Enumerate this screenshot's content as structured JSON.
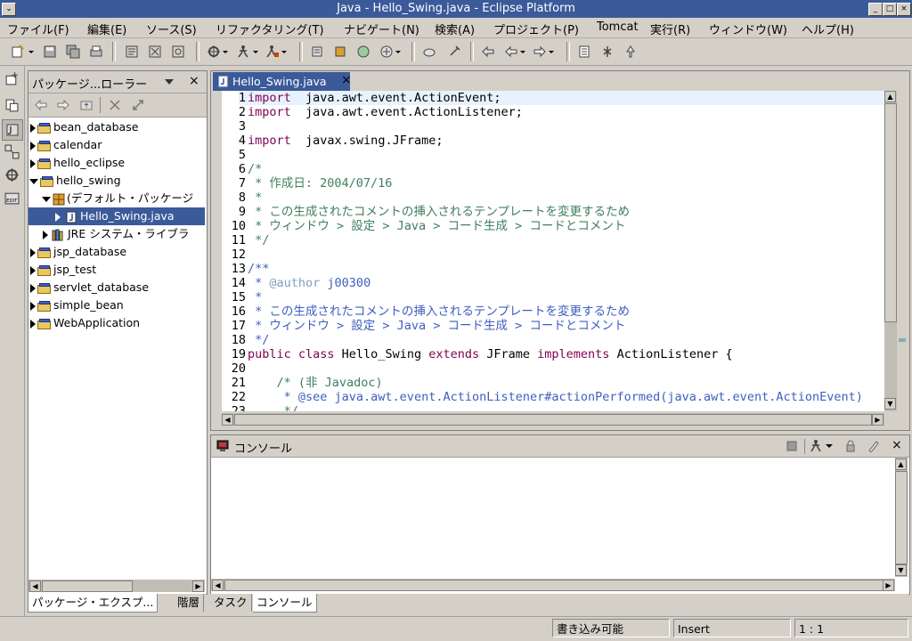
{
  "window": {
    "title": "Java - Hello_Swing.java - Eclipse Platform"
  },
  "menu": [
    "ファイル(F)",
    "編集(E)",
    "ソース(S)",
    "リファクタリング(T)",
    "ナビゲート(N)",
    "検索(A)",
    "プロジェクト(P)",
    "Tomcat",
    "実行(R)",
    "ウィンドウ(W)",
    "ヘルプ(H)"
  ],
  "explorer": {
    "title": "パッケージ...ローラー",
    "items": [
      {
        "label": "bean_database",
        "expanded": false
      },
      {
        "label": "calendar",
        "expanded": false
      },
      {
        "label": "hello_eclipse",
        "expanded": false
      },
      {
        "label": "hello_swing",
        "expanded": true
      },
      {
        "label": "(デフォルト・パッケージ",
        "expanded": true
      },
      {
        "label": "Hello_Swing.java",
        "selected": true
      },
      {
        "label": "JRE システム・ライブラ",
        "expanded": false
      },
      {
        "label": "jsp_database",
        "expanded": false
      },
      {
        "label": "jsp_test",
        "expanded": false
      },
      {
        "label": "servlet_database",
        "expanded": false
      },
      {
        "label": "simple_bean",
        "expanded": false
      },
      {
        "label": "WebApplication",
        "expanded": false
      }
    ],
    "bottom_tabs": [
      "パッケージ・エクスプ...",
      "階層"
    ]
  },
  "editor": {
    "tab": "Hello_Swing.java",
    "lines": [
      {
        "n": "1",
        "parts": [
          [
            "kw",
            "import"
          ],
          [
            "",
            "  java.awt.event.ActionEvent;"
          ]
        ]
      },
      {
        "n": "2",
        "parts": [
          [
            "kw",
            "import"
          ],
          [
            "",
            "  java.awt.event.ActionListener;"
          ]
        ]
      },
      {
        "n": "3",
        "parts": []
      },
      {
        "n": "4",
        "parts": [
          [
            "kw",
            "import"
          ],
          [
            "",
            "  javax.swing.JFrame;"
          ]
        ]
      },
      {
        "n": "5",
        "parts": []
      },
      {
        "n": "6",
        "parts": [
          [
            "cm",
            "/*"
          ]
        ]
      },
      {
        "n": "7",
        "parts": [
          [
            "cm",
            " * 作成日: 2004/07/16"
          ]
        ]
      },
      {
        "n": "8",
        "parts": [
          [
            "cm",
            " *"
          ]
        ]
      },
      {
        "n": "9",
        "parts": [
          [
            "cm",
            " * この生成されたコメントの挿入されるテンプレートを変更するため"
          ]
        ]
      },
      {
        "n": "10",
        "parts": [
          [
            "cm",
            " * ウィンドウ > 設定 > Java > コード生成 > コードとコメント"
          ]
        ]
      },
      {
        "n": "11",
        "parts": [
          [
            "cm",
            " */"
          ]
        ]
      },
      {
        "n": "12",
        "parts": []
      },
      {
        "n": "13",
        "parts": [
          [
            "jd",
            "/**"
          ]
        ]
      },
      {
        "n": "14",
        "parts": [
          [
            "jd",
            " * "
          ],
          [
            "jdt",
            "@author"
          ],
          [
            "jd",
            " j00300"
          ]
        ]
      },
      {
        "n": "15",
        "parts": [
          [
            "jd",
            " *"
          ]
        ]
      },
      {
        "n": "16",
        "parts": [
          [
            "jd",
            " * この生成されたコメントの挿入されるテンプレートを変更するため"
          ]
        ]
      },
      {
        "n": "17",
        "parts": [
          [
            "jd",
            " * ウィンドウ > 設定 > Java > コード生成 > コードとコメント"
          ]
        ]
      },
      {
        "n": "18",
        "parts": [
          [
            "jd",
            " */"
          ]
        ]
      },
      {
        "n": "19",
        "parts": [
          [
            "kw",
            "public class"
          ],
          [
            "",
            " Hello_Swing "
          ],
          [
            "kw",
            "extends"
          ],
          [
            "",
            " JFrame "
          ],
          [
            "kw",
            "implements"
          ],
          [
            "",
            " ActionListener {"
          ]
        ]
      },
      {
        "n": "20",
        "parts": []
      },
      {
        "n": "21",
        "parts": [
          [
            "",
            "    "
          ],
          [
            "cm",
            "/* (非 Javadoc)"
          ]
        ]
      },
      {
        "n": "22",
        "parts": [
          [
            "",
            "     "
          ],
          [
            "jd",
            "* @see java.awt.event.ActionListener#actionPerformed(java.awt.event.ActionEvent)"
          ]
        ]
      },
      {
        "n": "23",
        "parts": [
          [
            "",
            "     "
          ],
          [
            "cm",
            "*/"
          ]
        ]
      }
    ]
  },
  "console": {
    "title": "コンソール",
    "bottom_tabs": [
      "タスク",
      "コンソール"
    ]
  },
  "status": {
    "writable": "書き込み可能",
    "mode": "Insert",
    "position": "1 : 1"
  }
}
